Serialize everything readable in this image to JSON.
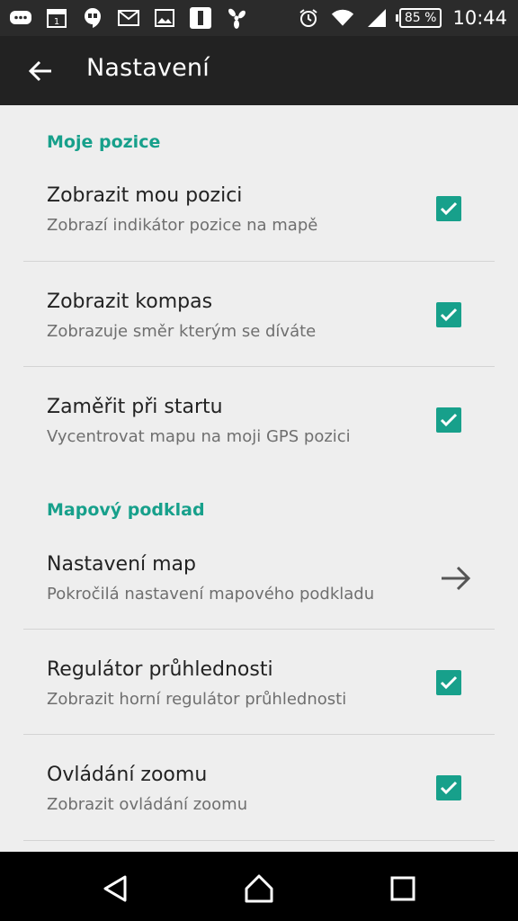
{
  "status_bar": {
    "left_icons": [
      "chat-bubble-icon",
      "calendar-icon",
      "hangouts-icon",
      "gmail-icon",
      "gallery-icon",
      "phone-icon",
      "fan-icon"
    ],
    "calendar_day": "1",
    "battery_text": "85 %",
    "time": "10:44"
  },
  "app_bar": {
    "title": "Nastavení"
  },
  "sections": [
    {
      "header": "Moje pozice"
    },
    {
      "header": "Mapový podklad"
    }
  ],
  "items": [
    {
      "title": "Zobrazit mou pozici",
      "subtitle": "Zobrazí indikátor pozice na mapě",
      "control": "checkbox",
      "checked": true
    },
    {
      "title": "Zobrazit kompas",
      "subtitle": "Zobrazuje směr kterým se díváte",
      "control": "checkbox",
      "checked": true
    },
    {
      "title": "Zaměřit při startu",
      "subtitle": "Vycentrovat mapu na moji GPS pozici",
      "control": "checkbox",
      "checked": true
    },
    {
      "title": "Nastavení map",
      "subtitle": "Pokročilá nastavení mapového podkladu",
      "control": "arrow"
    },
    {
      "title": "Regulátor průhlednosti",
      "subtitle": "Zobrazit horní regulátor průhlednosti",
      "control": "checkbox",
      "checked": true
    },
    {
      "title": "Ovládání zoomu",
      "subtitle": "Zobrazit ovládání zoomu",
      "control": "checkbox",
      "checked": true
    }
  ],
  "colors": {
    "accent": "#17a08b",
    "app_bar": "#222222",
    "status_bar": "#2b2b2b",
    "background": "#eeeeee"
  }
}
